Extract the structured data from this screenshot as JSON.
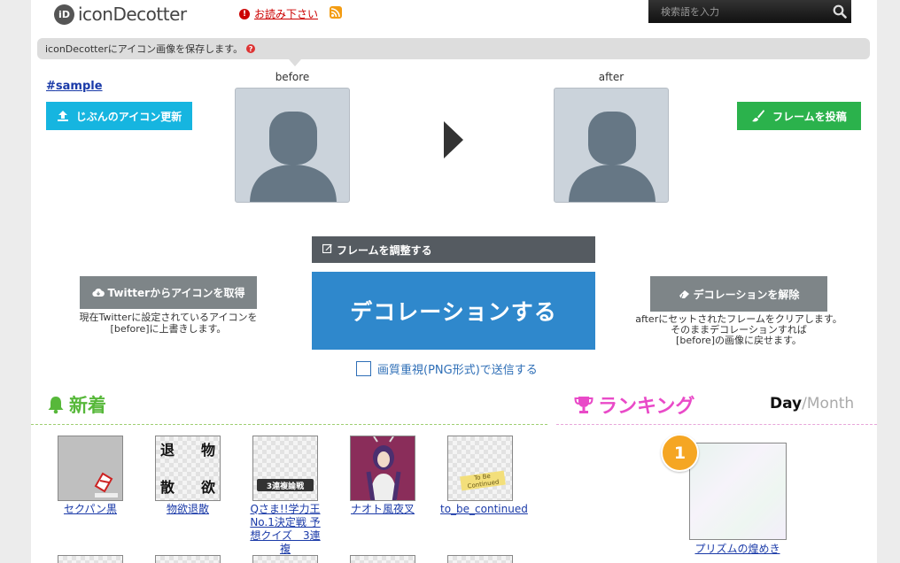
{
  "header": {
    "logo_mark": "iD",
    "logo_text": "iconDecotter",
    "readme_link": "お読み下さい",
    "search_placeholder": "検索語を入力"
  },
  "info_bar": {
    "text": "iconDecotterにアイコン画像を保存します。",
    "help_mark": "?"
  },
  "decorator": {
    "sample_link": "sample",
    "update_button": "じぶんのアイコン更新",
    "post_frame_button": "フレームを投稿",
    "before_label": "before",
    "after_label": "after",
    "adjust_frame_button": "フレームを調整する",
    "decorate_button": "デコレーションする",
    "png_checkbox_label": "画質重視(PNG形式)で送信する",
    "png_checked": false,
    "twitter_button": "Twitterからアイコンを取得",
    "twitter_desc": [
      "現在Twitterに設定されているアイコンを",
      "[before]に上書きします。"
    ],
    "clear_button": "デコレーションを解除",
    "clear_desc": [
      "afterにセットされたフレームをクリアします。",
      "そのままデコレーションすれば",
      "[before]の画像に戻せます。"
    ]
  },
  "new_section": {
    "title": "新着",
    "items": [
      {
        "caption": "セクパン黒"
      },
      {
        "caption": "物欲退散",
        "chars": [
          "退",
          "物",
          "散",
          "欲"
        ]
      },
      {
        "caption": "Qさま!!学力王No.1決定戦 予想クイズ　3連複",
        "stamp": "3連複論戦"
      },
      {
        "caption": "ナオト風夜叉"
      },
      {
        "caption": "to_be_continued",
        "sign": "To Be Continued"
      }
    ]
  },
  "ranking_section": {
    "title": "ランキング",
    "tab_day": "Day",
    "tab_sep": "/",
    "tab_month": "Month",
    "top_item": {
      "rank": "1",
      "caption": "プリズムの煌めき"
    }
  },
  "colors": {
    "update_button": "#16b5e0",
    "post_button": "#2bb24c",
    "decorate_button": "#2f88cc",
    "new_accent": "#57b83a",
    "ranking_accent": "#e94ac8",
    "rank_badge": "#f5a623"
  },
  "icons": {
    "search": "search-icon",
    "rss": "rss-icon",
    "upload": "upload-icon",
    "brush": "brush-icon",
    "edit": "edit-icon",
    "cloud_download": "cloud-download-icon",
    "eraser": "eraser-icon",
    "bell": "bell-icon",
    "trophy": "trophy-icon"
  }
}
